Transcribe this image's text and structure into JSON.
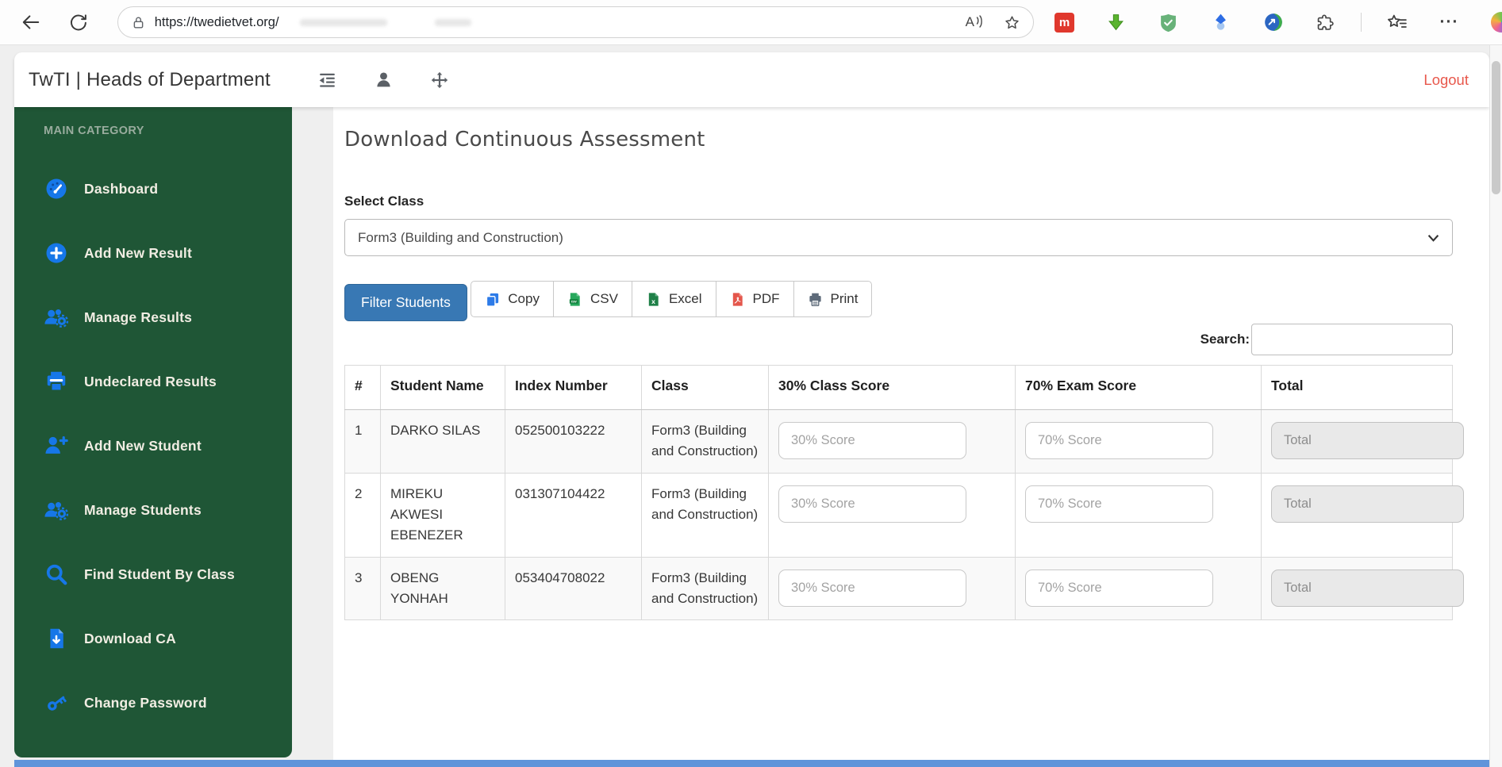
{
  "browser": {
    "url": "https://twedietvet.org/",
    "read_aloud_label": "A",
    "ellipsis": "···",
    "mendeley_letter": "m"
  },
  "header": {
    "title": "TwTI | Heads of Department",
    "logout": "Logout"
  },
  "sidebar": {
    "section": "MAIN CATEGORY",
    "items": [
      {
        "label": "Dashboard"
      },
      {
        "label": "Add New Result"
      },
      {
        "label": "Manage Results"
      },
      {
        "label": "Undeclared Results"
      },
      {
        "label": "Add New Student"
      },
      {
        "label": "Manage Students"
      },
      {
        "label": "Find Student By Class"
      },
      {
        "label": "Download CA"
      },
      {
        "label": "Change Password"
      }
    ]
  },
  "main": {
    "title": "Download Continuous Assessment",
    "select_class": {
      "label": "Select Class",
      "value": "Form3 (Building and Construction)"
    },
    "filter_button": "Filter Students",
    "export": {
      "copy": "Copy",
      "csv": "CSV",
      "excel": "Excel",
      "pdf": "PDF",
      "print": "Print"
    },
    "search": {
      "label": "Search:",
      "value": ""
    },
    "table": {
      "headers": {
        "num": "#",
        "name": "Student Name",
        "index": "Index Number",
        "class": "Class",
        "class_score": "30% Class Score",
        "exam_score": "70% Exam Score",
        "total": "Total"
      },
      "placeholders": {
        "class_score": "30% Score",
        "exam_score": "70% Score",
        "total": "Total"
      },
      "rows": [
        {
          "num": "1",
          "name": "DARKO SILAS",
          "index_number": "052500103222",
          "class": "Form3 (Building and Construction)"
        },
        {
          "num": "2",
          "name": "MIREKU AKWESI EBENEZER",
          "index_number": "031307104422",
          "class": "Form3 (Building and Construction)"
        },
        {
          "num": "3",
          "name": "OBENG YONHAH",
          "index_number": "053404708022",
          "class": "Form3 (Building and Construction)"
        }
      ]
    }
  },
  "colors": {
    "sidebar_green": "#1f5636",
    "icon_blue": "#1677e8",
    "filter_button_blue": "#3878b4",
    "logout_red": "#e8584c",
    "bottom_strip_blue": "#5f94da"
  }
}
